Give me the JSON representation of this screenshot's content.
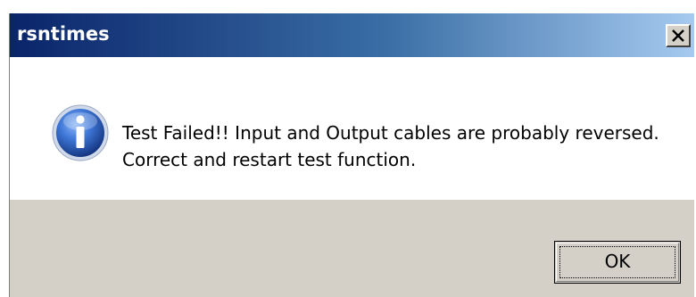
{
  "window": {
    "title": "rsntimes",
    "close_icon": "close-icon"
  },
  "message": {
    "icon": "info-icon",
    "line1": "Test Failed!! Input and Output cables are probably reversed.",
    "line2": "Correct and restart test function."
  },
  "buttons": {
    "ok_label": "OK"
  },
  "colors": {
    "titlebar_start": "#0a246a",
    "titlebar_end": "#a6caf0",
    "dialog_face": "#d4d0c8",
    "content_bg": "#ffffff",
    "info_icon_blue": "#2a5fc4"
  }
}
